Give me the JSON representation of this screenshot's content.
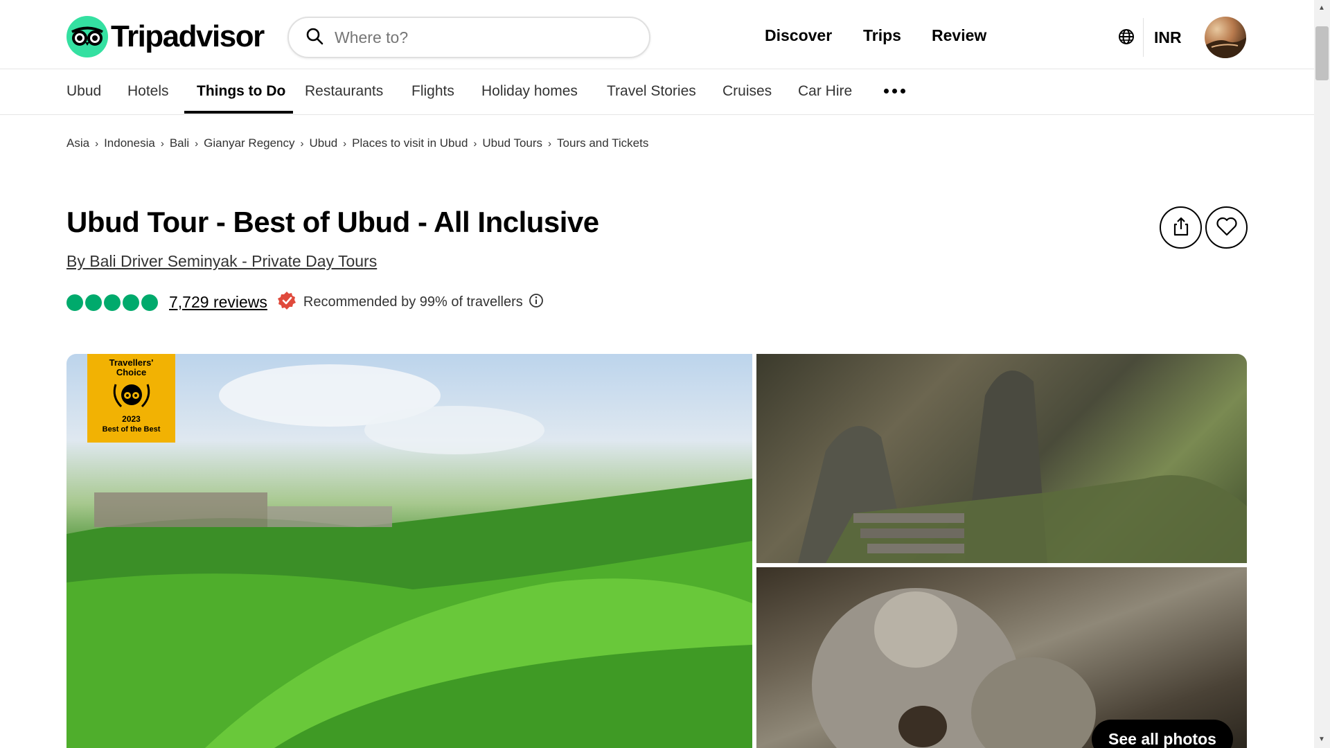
{
  "header": {
    "logo_text": "Tripadvisor",
    "search_placeholder": "Where to?",
    "nav": [
      "Discover",
      "Trips",
      "Review"
    ],
    "currency": "INR"
  },
  "subnav": {
    "items": [
      "Ubud",
      "Hotels",
      "Things to Do",
      "Restaurants",
      "Flights",
      "Holiday homes",
      "Travel Stories",
      "Cruises",
      "Car Hire"
    ],
    "active": "Things to Do"
  },
  "breadcrumb": [
    "Asia",
    "Indonesia",
    "Bali",
    "Gianyar Regency",
    "Ubud",
    "Places to visit in Ubud",
    "Ubud Tours",
    "Tours and Tickets"
  ],
  "listing": {
    "title": "Ubud Tour - Best of Ubud - All Inclusive",
    "byline": "By Bali Driver Seminyak - Private Day Tours",
    "rating_bubbles": 5,
    "reviews_link": "7,729 reviews",
    "recommended": "Recommended by 99% of travellers"
  },
  "badge": {
    "title_line1": "Travellers'",
    "title_line2": "Choice",
    "year": "2023",
    "subtitle": "Best of the Best"
  },
  "gallery": {
    "see_all_label": "See all photos"
  },
  "colors": {
    "brand_green": "#34e0a1",
    "rating_green": "#00aa6c",
    "badge_yellow": "#f2b203",
    "recommend_red": "#e04a3c"
  }
}
